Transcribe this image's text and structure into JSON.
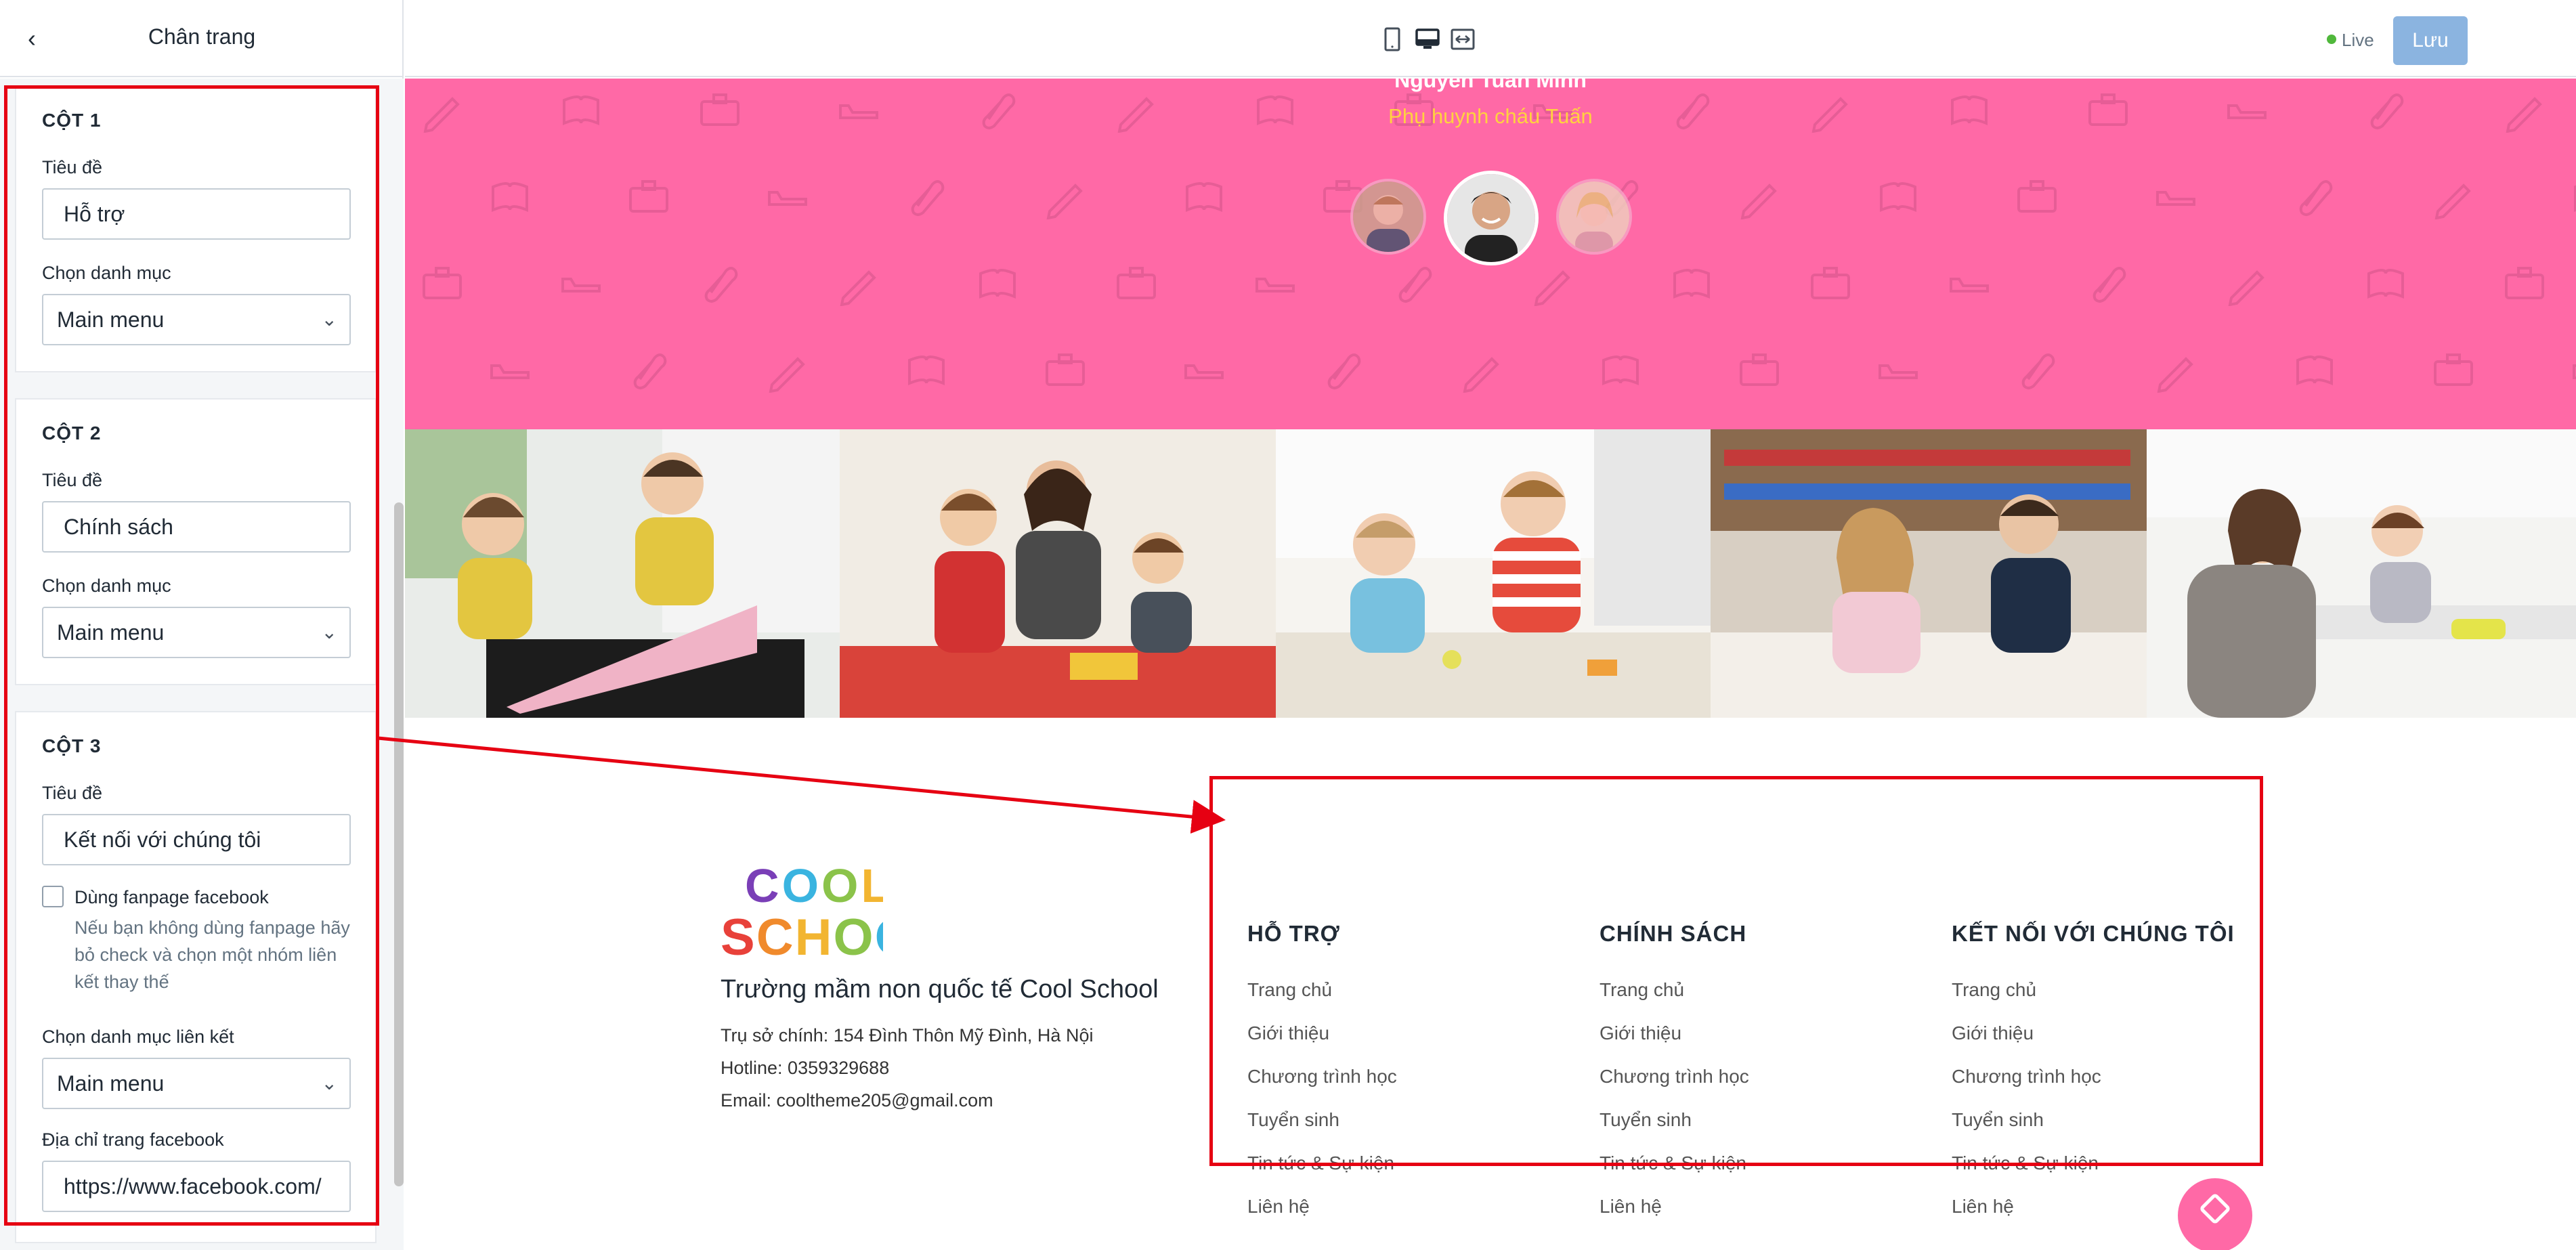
{
  "sidebar": {
    "title": "Chân trang",
    "columns": [
      {
        "heading": "CỘT 1",
        "title_label": "Tiêu đề",
        "title_value": "Hỗ trợ",
        "menu_label": "Chọn danh mục",
        "menu_value": "Main menu"
      },
      {
        "heading": "CỘT 2",
        "title_label": "Tiêu đề",
        "title_value": "Chính sách",
        "menu_label": "Chọn danh mục",
        "menu_value": "Main menu"
      },
      {
        "heading": "CỘT 3",
        "title_label": "Tiêu đề",
        "title_value": "Kết nối với chúng tôi",
        "fanpage_label": "Dùng fanpage facebook",
        "fanpage_help": "Nếu bạn không dùng fanpage hãy bỏ check và chọn một nhóm liên kết thay thế",
        "link_menu_label": "Chọn danh mục liên kết",
        "link_menu_value": "Main menu",
        "fb_label": "Địa chỉ trang facebook",
        "fb_value": "https://www.facebook.com/"
      }
    ]
  },
  "topbar": {
    "devices": [
      "tablet-icon",
      "desktop-icon",
      "fullwidth-icon"
    ],
    "live_label": "Live",
    "save_label": "Lưu"
  },
  "testimonial": {
    "name": "Nguyễn Tuấn Minh",
    "role": "Phụ huynh cháu Tuấn"
  },
  "footer": {
    "logo_top": "COOL",
    "logo_bottom": "SCHOOL",
    "school_name": "Trường mầm non quốc tế Cool School",
    "address": "Trụ sở chính: 154 Đình Thôn Mỹ Đình, Hà Nội",
    "hotline": "Hotline: 0359329688",
    "email": "Email: cooltheme205@gmail.com",
    "columns": [
      {
        "title": "HỖ TRỢ",
        "links": [
          "Trang chủ",
          "Giới thiệu",
          "Chương trình học",
          "Tuyển sinh",
          "Tin tức & Sự kiện",
          "Liên hệ"
        ]
      },
      {
        "title": "CHÍNH SÁCH",
        "links": [
          "Trang chủ",
          "Giới thiệu",
          "Chương trình học",
          "Tuyển sinh",
          "Tin tức & Sự kiện",
          "Liên hệ"
        ]
      },
      {
        "title": "KẾT NỐI VỚI CHÚNG TÔI",
        "links": [
          "Trang chủ",
          "Giới thiệu",
          "Chương trình học",
          "Tuyển sinh",
          "Tin tức & Sự kiện",
          "Liên hệ"
        ]
      }
    ]
  },
  "colors": {
    "accent_pink": "#ff69a6",
    "save_button": "#8bb4e0",
    "highlight_red": "#e60012",
    "live_green": "#50b83c"
  }
}
